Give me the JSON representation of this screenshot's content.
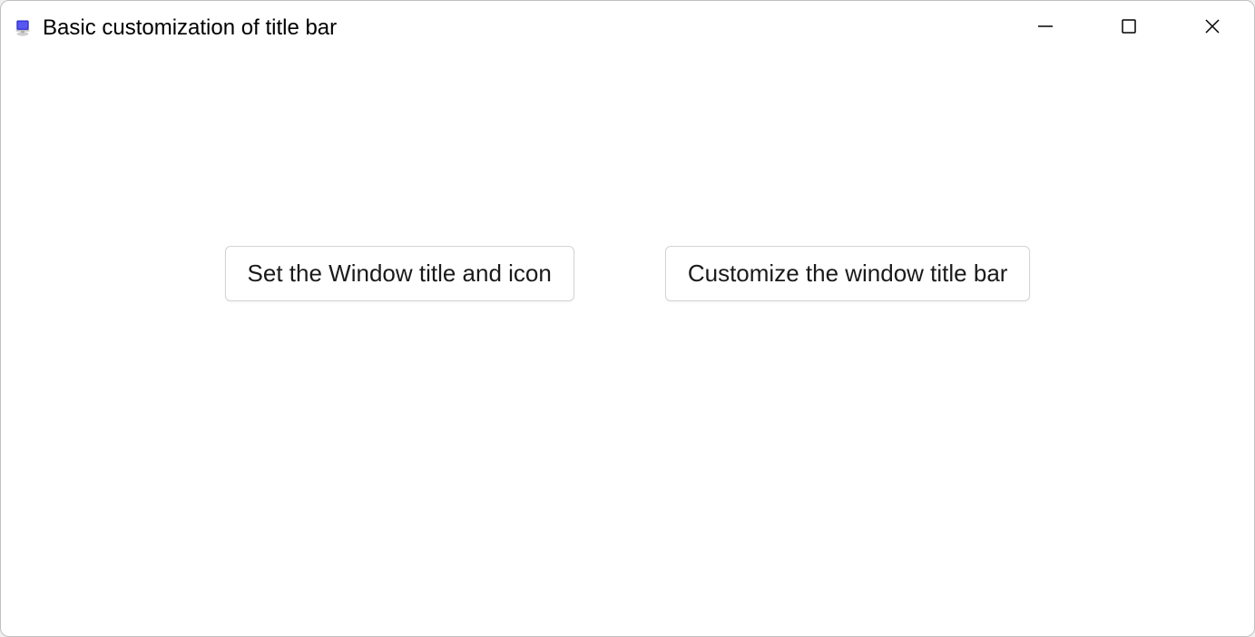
{
  "window": {
    "title": "Basic customization of title bar",
    "icon": "computer-icon"
  },
  "content": {
    "buttons": {
      "set_title": "Set the Window title and icon",
      "customize_bar": "Customize the window title bar"
    }
  }
}
